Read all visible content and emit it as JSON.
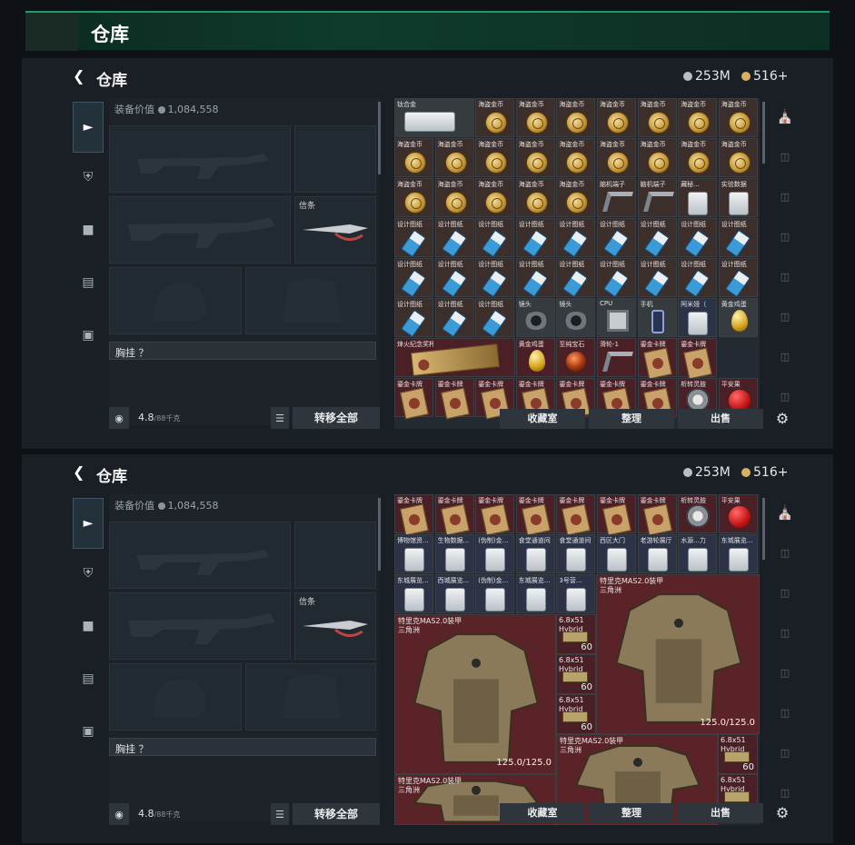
{
  "window": {
    "title": "仓库"
  },
  "header": {
    "title": "仓库",
    "currency_silver": "253M",
    "currency_gold": "516+"
  },
  "equipment": {
    "value_label": "装备价值",
    "value": "1,084,558",
    "slot_label": "信条",
    "chest_label": "胸挂 ？",
    "weight": "4.8",
    "weight_max": "/88千克",
    "move_all": "转移全部"
  },
  "actions": {
    "collection": "收藏室",
    "sort": "整理",
    "sell": "出售"
  },
  "grid1": {
    "r1": [
      "钛合金",
      "海盗金币",
      "海盗金币",
      "海盗金币",
      "海盗金币",
      "海盗金币",
      "海盗金币",
      "海盗金币"
    ],
    "r2": [
      "海盗金币",
      "海盗金币",
      "海盗金币",
      "海盗金币",
      "海盗金币",
      "海盗金币",
      "海盗金币",
      "海盗金币",
      "海盗金币"
    ],
    "r3": [
      "海盗金币",
      "海盗金币",
      "海盗金币",
      "海盗金币",
      "海盗金币",
      "脑机端子",
      "脑机端子",
      "藏秘...",
      "实验数据"
    ],
    "r4": [
      "设计图纸",
      "设计图纸",
      "设计图纸",
      "设计图纸",
      "设计图纸",
      "设计图纸",
      "设计图纸",
      "设计图纸",
      "设计图纸"
    ],
    "r5": [
      "设计图纸",
      "设计图纸",
      "设计图纸",
      "设计图纸",
      "设计图纸",
      "设计图纸",
      "设计图纸",
      "设计图纸",
      "设计图纸"
    ],
    "r6": [
      "设计图纸",
      "设计图纸",
      "设计图纸",
      "镜头",
      "镜头",
      "CPU",
      "手机",
      "阿米娅（",
      "黄金鸡蛋"
    ],
    "r7": [
      "烽火纪念奖杯",
      "黄金鸡蛋",
      "至纯宝石",
      "滑轮-1",
      "鎏金卡牌",
      "鎏金卡牌"
    ],
    "r8": [
      "鎏金卡牌",
      "鎏金卡牌",
      "鎏金卡牌",
      "鎏金卡牌",
      "鎏金卡牌",
      "鎏金卡牌",
      "鎏金卡牌",
      "析转灵肢",
      "平安果"
    ]
  },
  "grid2": {
    "r1": [
      "鎏金卡牌",
      "鎏金卡牌",
      "鎏金卡牌",
      "鎏金卡牌",
      "鎏金卡牌",
      "鎏金卡牌",
      "鎏金卡牌",
      "析转灵肢",
      "平安果"
    ],
    "r2": [
      "博物馆资...",
      "生物数据...",
      "(伪制)金...",
      "食堂通道间",
      "食堂通道间",
      "西区大门",
      "老游轮展厅",
      "水源...力",
      "东城展览..."
    ],
    "r3": [
      "东城展览...",
      "西城展览...",
      "(伪制)金...",
      "东城展览...",
      "3号营..."
    ],
    "armor_name": "特里克MAS2.0装甲",
    "armor_sub": "三角洲",
    "ammo_name": "6.8x51",
    "ammo_sub": "Hybrid",
    "ammo_count": "60",
    "durability": "125.0/125.0"
  }
}
